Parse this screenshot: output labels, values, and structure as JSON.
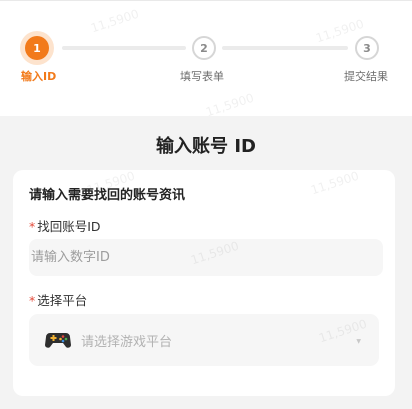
{
  "steps": [
    {
      "number": "1",
      "label": "输入ID",
      "active": true
    },
    {
      "number": "2",
      "label": "填写表单",
      "active": false
    },
    {
      "number": "3",
      "label": "提交结果",
      "active": false
    }
  ],
  "page_title": "输入账号 ID",
  "card": {
    "heading": "请输入需要找回的账号资讯",
    "required_mark": "*",
    "account_field": {
      "label": "找回账号ID",
      "placeholder": "请输入数字ID",
      "value": ""
    },
    "platform_field": {
      "label": "选择平台",
      "placeholder": "请选择游戏平台",
      "icon": "gamepad-icon"
    }
  },
  "watermark_text": "11,5900",
  "colors": {
    "accent": "#f27a1a",
    "required": "#e34a3a"
  }
}
